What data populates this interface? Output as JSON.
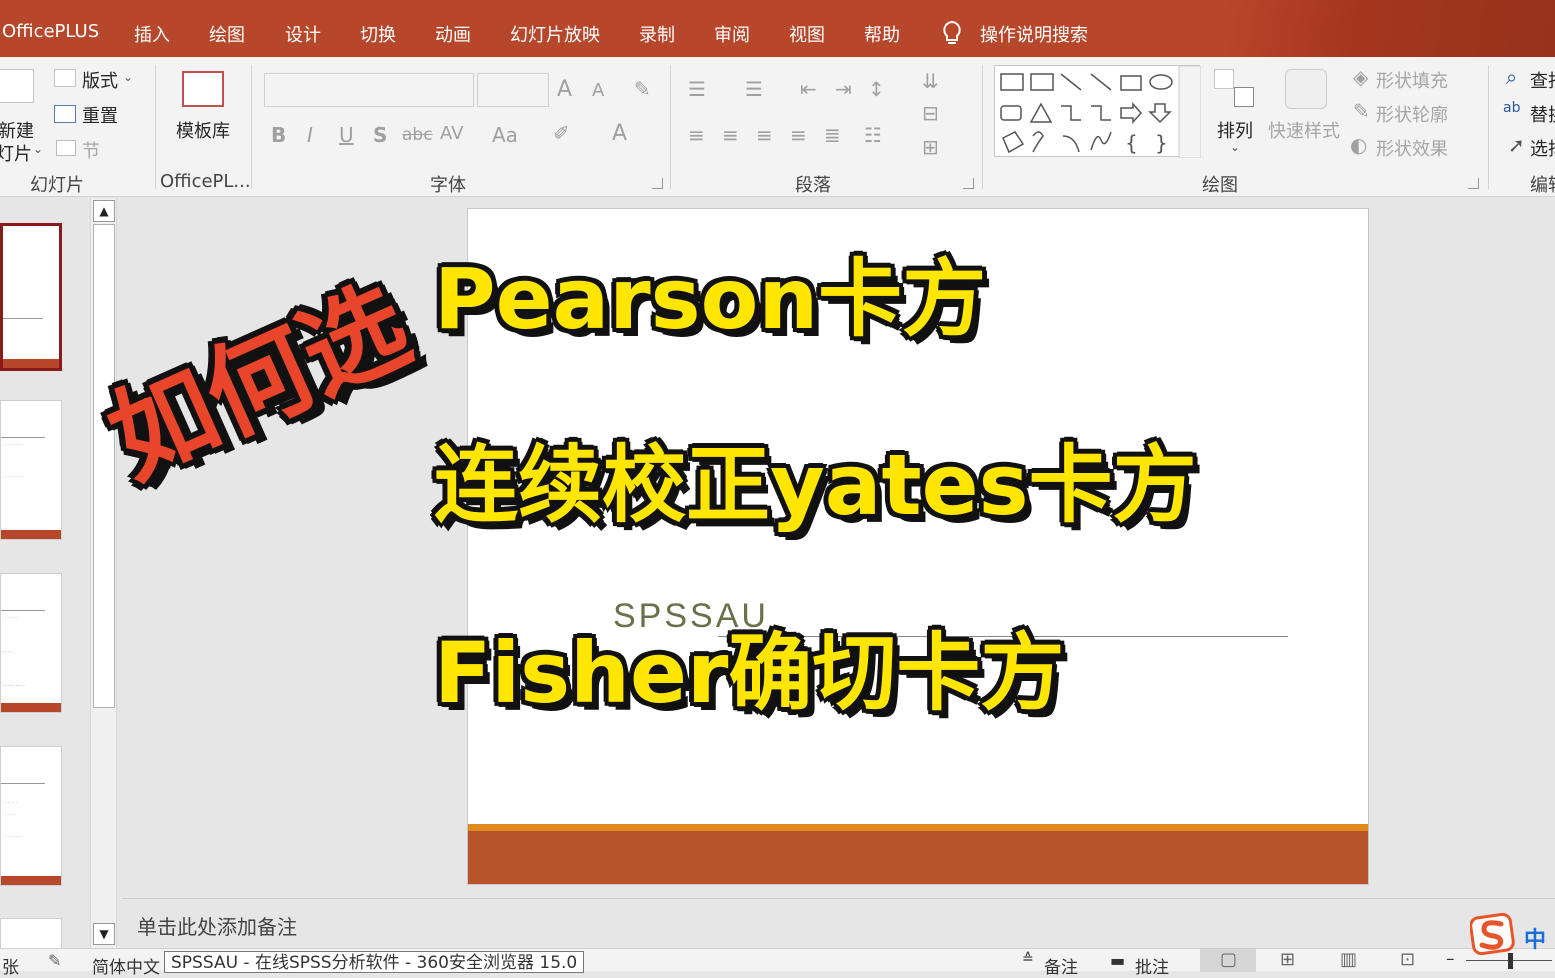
{
  "menubar": {
    "items": [
      "OfficePLUS",
      "插入",
      "绘图",
      "设计",
      "切换",
      "动画",
      "幻灯片放映",
      "录制",
      "审阅",
      "视图",
      "帮助"
    ],
    "search_label": "操作说明搜索"
  },
  "ribbon": {
    "slides_group": {
      "new_slide_line1": "新建",
      "new_slide_line2": "灯片",
      "layout": "版式",
      "reset": "重置",
      "section": "节",
      "label": "幻灯片"
    },
    "officeplus_group": {
      "template_library": "模板库",
      "label": "OfficePL..."
    },
    "font_group": {
      "label": "字体",
      "bold": "B",
      "italic": "I",
      "underline": "U",
      "shadow": "S",
      "strike": "abc",
      "spacing": "AV",
      "case": "Aa",
      "grow": "A",
      "shrink": "A",
      "color": "A"
    },
    "paragraph_group": {
      "label": "段落"
    },
    "drawing_group": {
      "arrange": "排列",
      "quick_styles": "快速样式",
      "shape_fill": "形状填充",
      "shape_outline": "形状轮廓",
      "shape_effects": "形状效果",
      "label": "绘图"
    },
    "editing_group": {
      "find": "查找",
      "replace": "替换",
      "select": "选择",
      "label": "编辑"
    }
  },
  "slide": {
    "subtitle": "SPSSAU"
  },
  "overlay": {
    "line1": "Pearson卡方",
    "line2": "连续校正yates卡方",
    "line3": "Fisher确切卡方",
    "slanted": "如何选"
  },
  "notes": {
    "placeholder": "单击此处添加备注"
  },
  "status": {
    "slide_count": "张",
    "language": "简体中文",
    "tooltip": "SPSSAU - 在线SPSS分析软件 - 360安全浏览器 15.0",
    "notes_btn": "备注",
    "comments_btn": "批注",
    "ime": "中"
  },
  "colors": {
    "accent": "#b7472a",
    "overlay_yellow": "#ffe600",
    "overlay_red": "#e8452a"
  }
}
